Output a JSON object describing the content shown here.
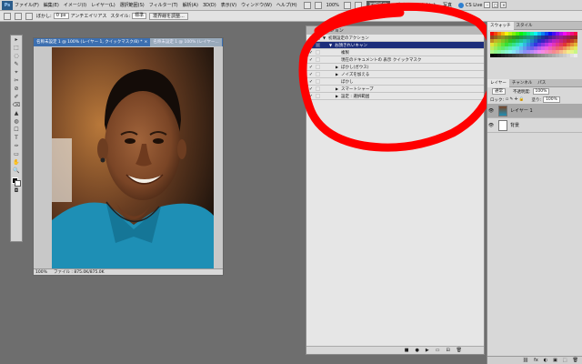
{
  "menubar": {
    "logo": "Ps",
    "items": [
      "ファイル(F)",
      "編集(E)",
      "イメージ(I)",
      "レイヤー(L)",
      "選択範囲(S)",
      "フィルター(T)",
      "解析(A)",
      "3D(D)",
      "表示(V)",
      "ウィンドウ(W)",
      "ヘルプ(H)"
    ],
    "zoom": "100%",
    "workspaces": [
      "初期設定",
      "デザイン",
      "ペイント",
      "写真"
    ],
    "cs_live": "CS Live"
  },
  "optbar": {
    "feather_label": "ぼかし:",
    "feather_value": "0 px",
    "antialias_label": "アンチエイリアス",
    "style_label": "スタイル:",
    "style_value": "標準",
    "refine_label": "境界線を調整..."
  },
  "document": {
    "tabs": [
      "名称未設定 1 @ 100% (レイヤー 1, クイックマスク/8) *",
      "名称未設定 1 @ 100% (レイヤー..."
    ],
    "status_zoom": "100%",
    "status_info": "ファイル : 875.0K/875.0K"
  },
  "actions": {
    "title": "アクション",
    "rows": [
      {
        "label": "初期設定のアクション",
        "check": "✓",
        "dialog": true,
        "triangle": "▼",
        "depth": 0,
        "selected": false
      },
      {
        "label": "お顔きれいキャン",
        "check": "✓",
        "dialog": false,
        "triangle": "▼",
        "depth": 1,
        "selected": true
      },
      {
        "label": "複製",
        "check": "✓",
        "dialog": false,
        "triangle": "",
        "depth": 2,
        "selected": false
      },
      {
        "label": "現在のドキュメントの 表示 クイックマスク",
        "check": "✓",
        "dialog": false,
        "triangle": "",
        "depth": 2,
        "selected": false
      },
      {
        "label": "ぼかし(ガウス)",
        "check": "✓",
        "dialog": false,
        "triangle": "▶",
        "depth": 2,
        "selected": false
      },
      {
        "label": "ノイズを加える",
        "check": "✓",
        "dialog": false,
        "triangle": "▶",
        "depth": 2,
        "selected": false
      },
      {
        "label": "ぼかし",
        "check": "✓",
        "dialog": false,
        "triangle": "",
        "depth": 2,
        "selected": false
      },
      {
        "label": "スマートシャープ",
        "check": "✓",
        "dialog": false,
        "triangle": "▶",
        "depth": 2,
        "selected": false
      },
      {
        "label": "設定 : 選択範囲",
        "check": "✓",
        "dialog": false,
        "triangle": "▶",
        "depth": 2,
        "selected": false
      }
    ],
    "footer_buttons": [
      "■",
      "●",
      "▶",
      "▭",
      "⊟",
      "🗑"
    ]
  },
  "annotation": {
    "color": "#ff0000"
  },
  "right_col": {
    "swatch_tabs": [
      "スウォッチ",
      "スタイル"
    ],
    "layer_tabs": [
      "レイヤー",
      "チャンネル",
      "パス"
    ],
    "blend_mode": "通常",
    "opacity_label": "不透明度:",
    "opacity_value": "100%",
    "lock_label": "ロック:",
    "fill_label": "塗り:",
    "fill_value": "100%",
    "layers": [
      {
        "name": "レイヤー 1",
        "selected": true,
        "thumb": "photo"
      },
      {
        "name": "背景",
        "selected": false,
        "thumb": "white"
      }
    ],
    "footer_icons": [
      "⛓",
      "fx",
      "◐",
      "▣",
      "⬚",
      "🗑"
    ]
  },
  "tools": [
    "▸",
    "⬚",
    "◌",
    "✎",
    "⌖",
    "✂",
    "⊘",
    "✐",
    "⌫",
    "▲",
    "◍",
    "☐",
    "T",
    "✑",
    "▭",
    "✋",
    "🔍"
  ]
}
